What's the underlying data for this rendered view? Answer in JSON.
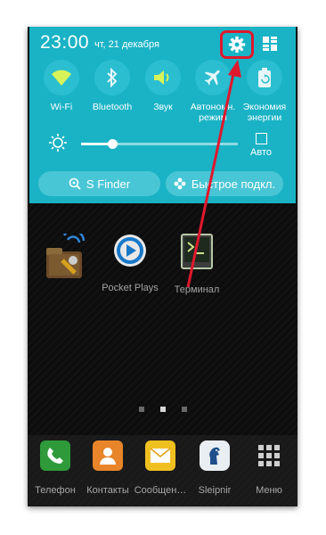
{
  "status": {
    "time": "23:00",
    "date": "чт, 21 декабря"
  },
  "quick_settings": {
    "toggles": [
      {
        "label": "Wi-Fi",
        "icon": "wifi-icon"
      },
      {
        "label": "Bluetooth",
        "icon": "bluetooth-icon"
      },
      {
        "label": "Звук",
        "icon": "sound-icon"
      },
      {
        "label_line1": "Автономн.",
        "label_line2": "режим",
        "icon": "airplane-icon"
      },
      {
        "label_line1": "Экономия",
        "label_line2": "энергии",
        "icon": "power-saving-icon"
      }
    ],
    "brightness": {
      "auto_label": "Авто",
      "level": 0.2
    },
    "actions": {
      "s_finder": "S Finder",
      "quick_connect": "Быстрое подкл."
    }
  },
  "home_apps": [
    {
      "label": "",
      "icon": "tools-app-icon"
    },
    {
      "label": "Pocket Plays",
      "icon": "pocket-plays-icon"
    },
    {
      "label": "Терминал",
      "icon": "terminal-icon"
    }
  ],
  "dock": [
    {
      "label": "Телефон",
      "icon": "phone-icon"
    },
    {
      "label": "Контакты",
      "icon": "contacts-icon"
    },
    {
      "label": "Сообщен…",
      "icon": "messages-icon"
    },
    {
      "label": "Sleipnir",
      "icon": "sleipnir-icon"
    },
    {
      "label": "Меню",
      "icon": "apps-menu-icon"
    }
  ],
  "colors": {
    "panel": "#19b3c5",
    "highlight": "#e0182d"
  }
}
